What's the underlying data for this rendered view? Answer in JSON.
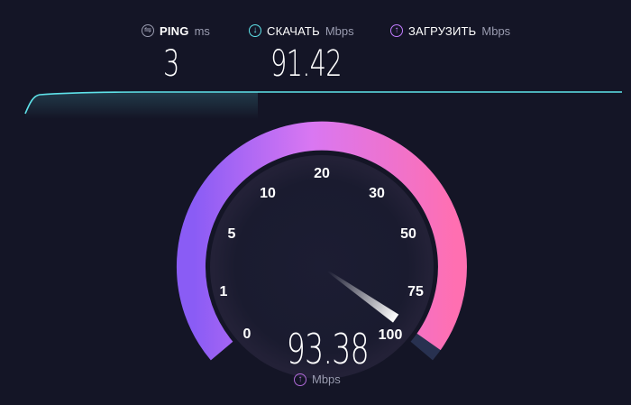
{
  "metrics": {
    "ping": {
      "label": "PING",
      "unit": "ms",
      "value": "3",
      "icon": "ping-icon"
    },
    "download": {
      "label": "СКАЧАТЬ",
      "unit": "Mbps",
      "value": "91.42",
      "icon": "download-arrow-icon"
    },
    "upload": {
      "label": "ЗАГРУЗИТЬ",
      "unit": "Mbps",
      "value": "",
      "icon": "upload-arrow-icon"
    }
  },
  "gauge": {
    "ticks": [
      "0",
      "1",
      "5",
      "10",
      "20",
      "30",
      "50",
      "75",
      "100"
    ],
    "current_value": "93.38",
    "unit": "Mbps",
    "needle_level": 0.98,
    "colors": {
      "start": "#8a5cf5",
      "mid": "#d977f2",
      "end": "#ff6fb1",
      "track": "#283150",
      "download_line": "#5fe3ea"
    }
  }
}
